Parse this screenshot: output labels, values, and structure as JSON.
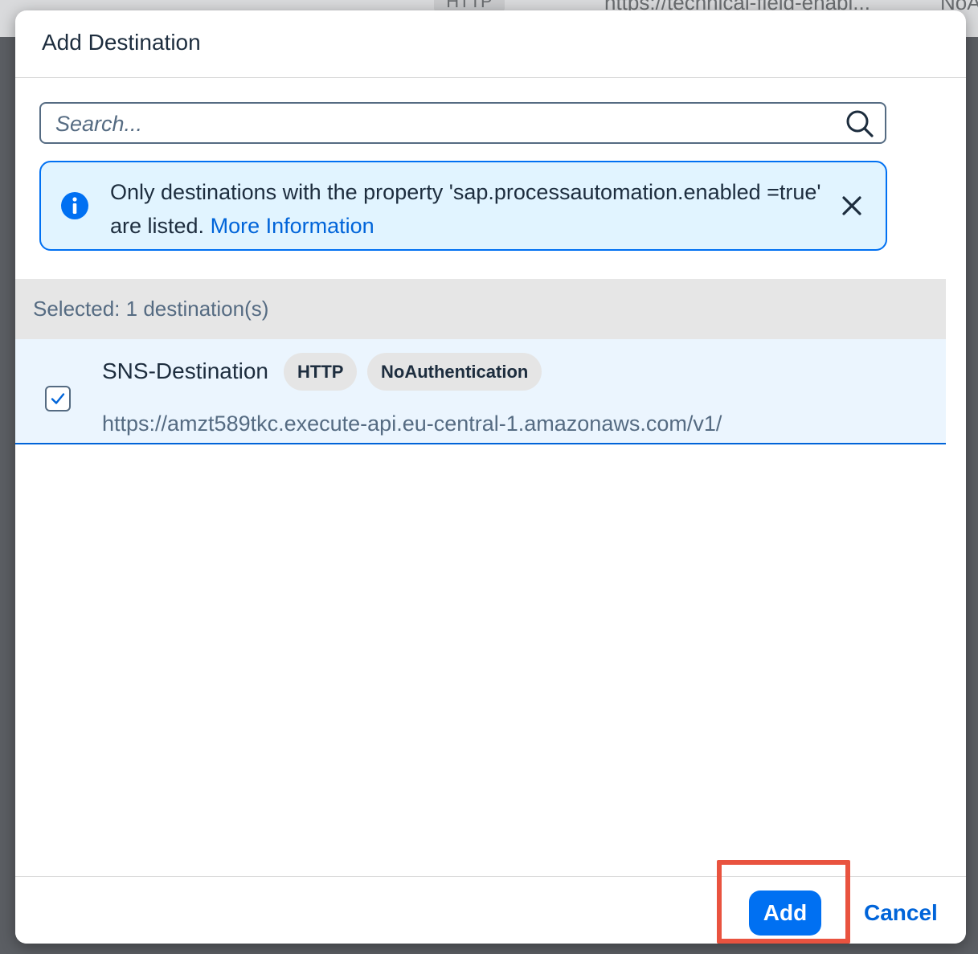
{
  "background": {
    "tag_partial": "HTTP",
    "url_partial": "https://technical-field-enabl...",
    "auth_partial": "NoA"
  },
  "dialog": {
    "title": "Add Destination",
    "search": {
      "placeholder": "Search...",
      "value": ""
    },
    "info": {
      "message": "Only destinations with the property 'sap.processautomation.enabled =true' are listed.",
      "link": "More Information"
    },
    "selected_label": "Selected: 1 destination(s)",
    "destinations": [
      {
        "name": "SNS-Destination",
        "type_tag": "HTTP",
        "auth_tag": "NoAuthentication",
        "url": "https://amzt589tkc.execute-api.eu-central-1.amazonaws.com/v1/",
        "checked": true
      }
    ],
    "footer": {
      "add_label": "Add",
      "cancel_label": "Cancel"
    }
  },
  "colors": {
    "accent": "#0070f2",
    "link": "#0064d9",
    "info_background": "#e1f4ff",
    "highlight": "#e9533f"
  },
  "icons": [
    "search-icon",
    "info-icon",
    "close-icon",
    "checkmark-icon"
  ]
}
